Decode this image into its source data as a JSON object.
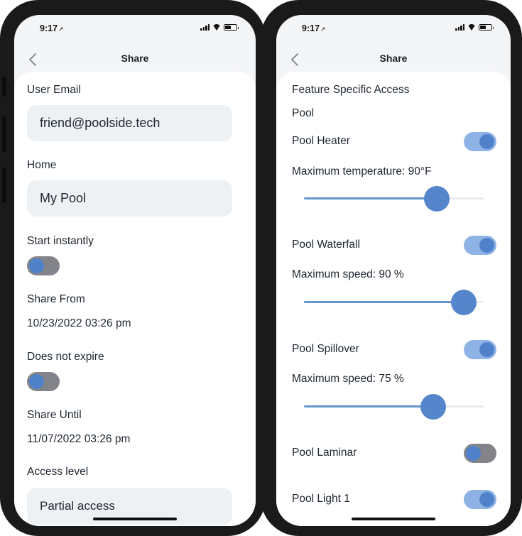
{
  "left": {
    "status": {
      "time": "9:17",
      "loc": "↗"
    },
    "nav": {
      "title": "Share"
    },
    "user_email": {
      "label": "User Email",
      "value": "friend@poolside.tech"
    },
    "home": {
      "label": "Home",
      "value": "My Pool"
    },
    "start_instantly": {
      "label": "Start instantly",
      "on": false
    },
    "share_from": {
      "label": "Share From",
      "value": "10/23/2022 03:26 pm"
    },
    "does_not_expire": {
      "label": "Does not expire",
      "on": false
    },
    "share_until": {
      "label": "Share Until",
      "value": "11/07/2022 03:26 pm"
    },
    "access_level": {
      "label": "Access level",
      "value": "Partial access"
    }
  },
  "right": {
    "status": {
      "time": "9:17",
      "loc": "↗"
    },
    "nav": {
      "title": "Share"
    },
    "section_title": "Feature Specific Access",
    "group_title": "Pool",
    "features": [
      {
        "name": "Pool Heater",
        "on": true,
        "limit_label": "Maximum temperature: 90°F",
        "slider_fraction": 0.74
      },
      {
        "name": "Pool Waterfall",
        "on": true,
        "limit_label": "Maximum speed: 90 %",
        "slider_fraction": 0.89
      },
      {
        "name": "Pool Spillover",
        "on": true,
        "limit_label": "Maximum speed: 75 %",
        "slider_fraction": 0.72
      },
      {
        "name": "Pool Laminar",
        "on": false
      },
      {
        "name": "Pool Light 1",
        "on": true
      }
    ]
  },
  "colors": {
    "accent": "#5585cb",
    "toggle_on_track": "#8eb2e3",
    "toggle_off_track": "#828489",
    "field_bg": "#eef1f4"
  },
  "icons": {
    "back": "chevron-left-icon",
    "signal": "cellular-signal-icon",
    "wifi": "wifi-icon",
    "battery": "battery-icon",
    "location": "location-arrow-icon"
  }
}
